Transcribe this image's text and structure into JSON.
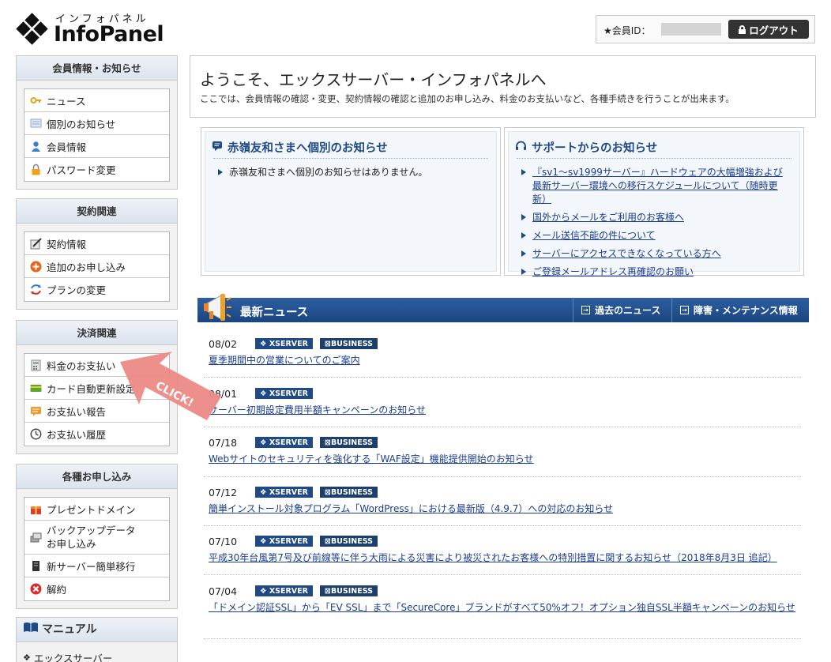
{
  "header": {
    "logo_sub": "インフォパネル",
    "logo_main": "InfoPanel",
    "member_label": "★会員ID：",
    "logout_label": "ログアウト"
  },
  "sidebar": {
    "sections": [
      {
        "title": "会員情報・お知らせ",
        "items": [
          "ニュース",
          "個別のお知らせ",
          "会員情報",
          "パスワード変更"
        ]
      },
      {
        "title": "契約関連",
        "items": [
          "契約情報",
          "追加のお申し込み",
          "プランの変更"
        ]
      },
      {
        "title": "決済関連",
        "items": [
          "料金のお支払い",
          "カード自動更新設定",
          "お支払い報告",
          "お支払い履歴"
        ]
      },
      {
        "title": "各種お申し込み",
        "items": [
          "プレゼントドメイン",
          "バックアップデータ",
          "お申し込み",
          "新サーバー簡単移行",
          "解約"
        ]
      }
    ],
    "manual_title": "マニュアル",
    "manual_item": "エックスサーバー"
  },
  "welcome": {
    "title": "ようこそ、エックスサーバー・インフォパネルへ",
    "desc": "ここでは、会員情報の確認・変更、契約情報の確認と追加のお申し込み、料金のお支払いなど、各種手続きを行うことが出来ます。"
  },
  "personal_notice": {
    "title": "赤嶺友和さまへ個別のお知らせ",
    "items": [
      "赤嶺友和さまへ個別のお知らせはありません。"
    ]
  },
  "support_notice": {
    "title": "サポートからのお知らせ",
    "items": [
      "『sv1～sv1999サーバー』ハードウェアの大幅増強および最新サーバー環境への移行スケジュールについて（随時更新）",
      "国外からメールをご利用のお客様へ",
      "メール送信不能の件について",
      "サーバーにアクセスできなくなっている方へ",
      "ご登録メールアドレス再確認のお願い"
    ]
  },
  "news": {
    "title": "最新ニュース",
    "past_label": "過去のニュース",
    "maint_label": "障害・メンテナンス情報",
    "tag_xserver": "XSERVER",
    "tag_business": "BUSINESS",
    "items": [
      {
        "date": "08/02",
        "business": true,
        "title": "夏季期間中の営業についてのご案内"
      },
      {
        "date": "08/01",
        "business": false,
        "title": "サーバー初期設定費用半額キャンペーンのお知らせ"
      },
      {
        "date": "07/18",
        "business": true,
        "title": "Webサイトのセキュリティを強化する「WAF設定」機能提供開始のお知らせ"
      },
      {
        "date": "07/12",
        "business": true,
        "title": "簡単インストール対象プログラム「WordPress」における最新版（4.9.7）への対応のお知らせ"
      },
      {
        "date": "07/10",
        "business": true,
        "title": "平成30年台風第7号及び前線等に伴う大雨による災害により被災されたお客様への特別措置に関するお知らせ（2018年8月3日 追記）"
      },
      {
        "date": "07/04",
        "business": true,
        "title": "「ドメイン認証SSL」から「EV SSL」まで「SecureCore」ブランドがすべて50%オフ！オプション独自SSL半額キャンペーンのお知らせ"
      }
    ]
  },
  "annotation": {
    "click_label": "CLICK!",
    "color": "#ec8a86"
  },
  "colors": {
    "accent_blue": "#1e4a85",
    "news_bar": "#2d5ea1",
    "link": "#1a3d8f"
  }
}
